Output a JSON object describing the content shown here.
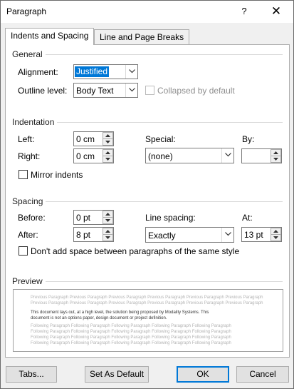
{
  "window": {
    "title": "Paragraph",
    "help_label": "?",
    "close_label": "✕"
  },
  "tabs": [
    {
      "label": "Indents and Spacing",
      "active": true
    },
    {
      "label": "Line and Page Breaks",
      "active": false
    }
  ],
  "general": {
    "section_label": "General",
    "alignment_label": "Alignment:",
    "alignment_value": "Justified",
    "outline_label": "Outline level:",
    "outline_value": "Body Text",
    "collapsed_label": "Collapsed by default"
  },
  "indentation": {
    "section_label": "Indentation",
    "left_label": "Left:",
    "left_value": "0 cm",
    "right_label": "Right:",
    "right_value": "0 cm",
    "special_label": "Special:",
    "special_value": "(none)",
    "by_label": "By:",
    "by_value": "",
    "mirror_label": "Mirror indents"
  },
  "spacing": {
    "section_label": "Spacing",
    "before_label": "Before:",
    "before_value": "0 pt",
    "after_label": "After:",
    "after_value": "8 pt",
    "line_spacing_label": "Line spacing:",
    "line_spacing_value": "Exactly",
    "at_label": "At:",
    "at_value": "13 pt",
    "dont_add_label": "Don't add space between paragraphs of the same style"
  },
  "preview": {
    "section_label": "Preview",
    "prev_line_1": "Previous Paragraph Previous Paragraph Previous Paragraph Previous Paragraph Previous Paragraph Previous Paragraph",
    "prev_line_2": "Previous Paragraph Previous Paragraph Previous Paragraph Previous Paragraph Previous Paragraph Previous Paragraph",
    "body_line_1": "This document lays out, at a high level, the solution being proposed by Modality Systems. This",
    "body_line_2": "document is not an options paper, design document or project definition.",
    "follow_line": "Following Paragraph Following Paragraph Following Paragraph Following Paragraph Following Paragraph"
  },
  "buttons": {
    "tabs": "Tabs...",
    "set_default": "Set As Default",
    "ok": "OK",
    "cancel": "Cancel"
  },
  "colors": {
    "accent": "#0078d7",
    "window_bg": "#f0f0f0"
  }
}
